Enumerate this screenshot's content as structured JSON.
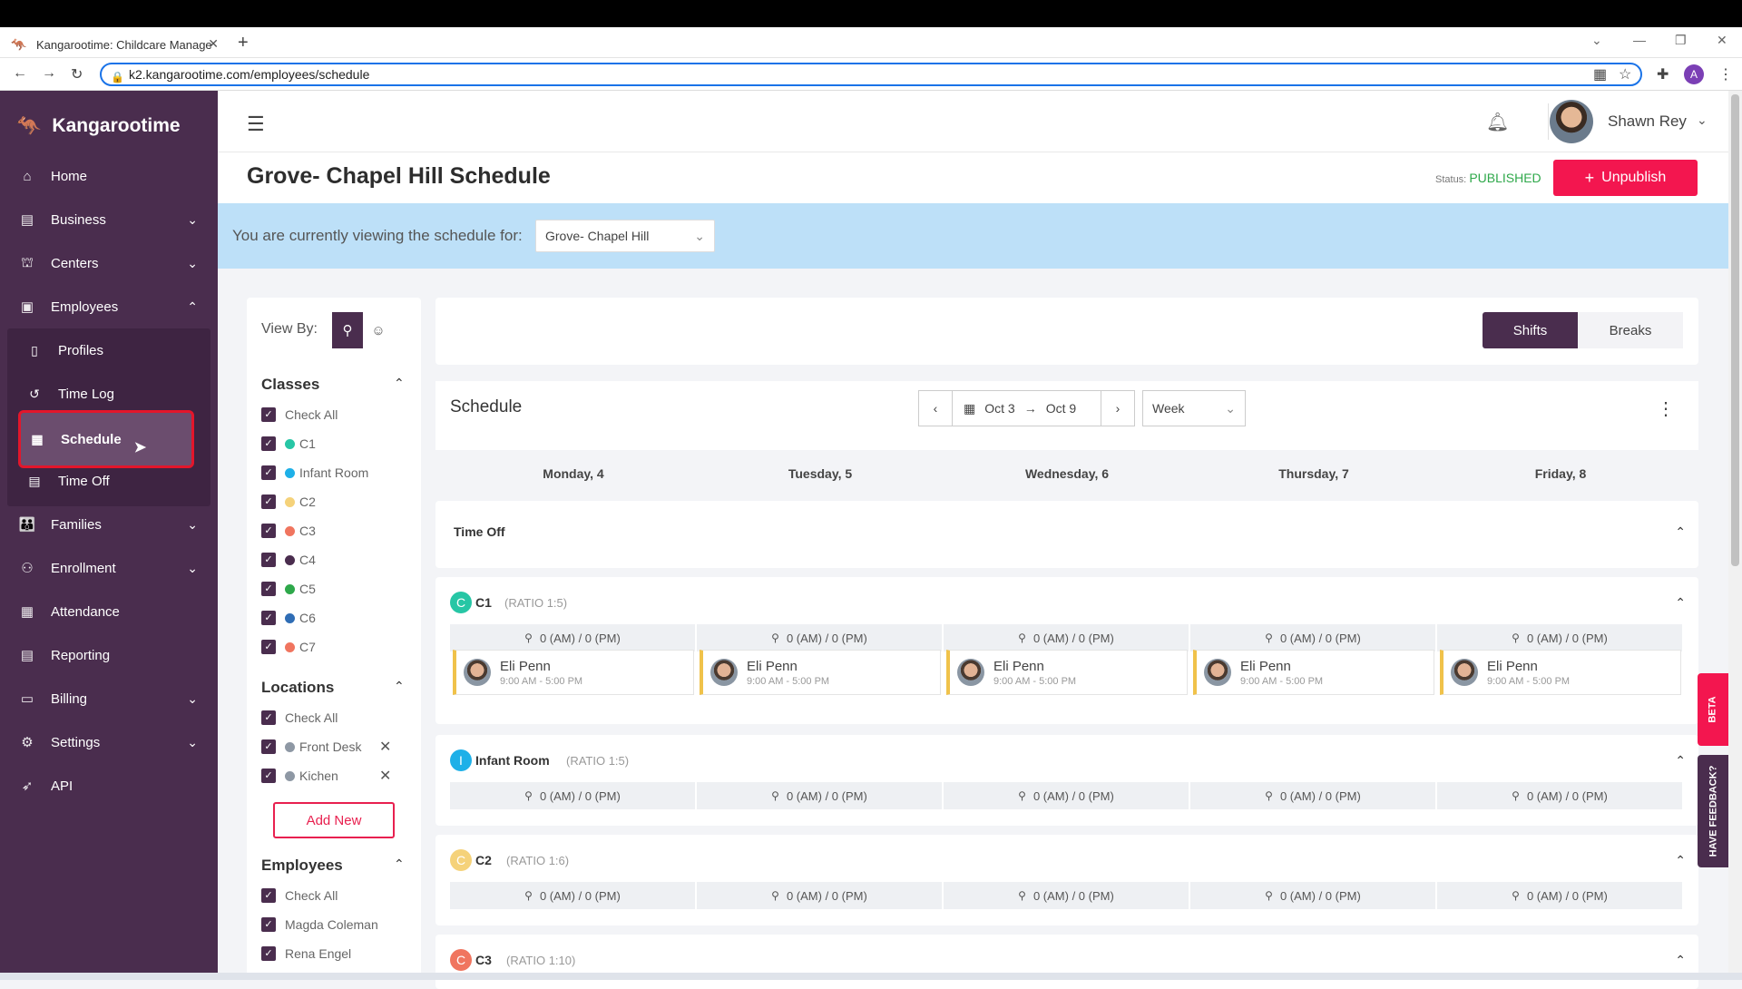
{
  "browser": {
    "tab_title": "Kangarootime: Childcare Manage",
    "url": "k2.kangarootime.com/employees/schedule"
  },
  "sidebar": {
    "brand": "Kangarootime",
    "items": [
      {
        "label": "Home",
        "icon": "home-icon"
      },
      {
        "label": "Business",
        "icon": "building-icon"
      },
      {
        "label": "Centers",
        "icon": "center-icon"
      },
      {
        "label": "Employees",
        "icon": "badge-icon"
      },
      {
        "label": "Families",
        "icon": "people-icon"
      },
      {
        "label": "Enrollment",
        "icon": "add-user-icon"
      },
      {
        "label": "Attendance",
        "icon": "calendar-check-icon"
      },
      {
        "label": "Reporting",
        "icon": "report-icon"
      },
      {
        "label": "Billing",
        "icon": "card-icon"
      },
      {
        "label": "Settings",
        "icon": "gear-icon"
      },
      {
        "label": "API",
        "icon": "rocket-icon"
      }
    ],
    "sub_items": [
      {
        "label": "Profiles"
      },
      {
        "label": "Time Log"
      },
      {
        "label": "Schedule"
      },
      {
        "label": "Time Off"
      }
    ]
  },
  "header": {
    "user_name": "Shawn Rey"
  },
  "page": {
    "title": "Grove- Chapel Hill Schedule",
    "status_label": "Status:",
    "status_value": "PUBLISHED",
    "unpublish_label": "Unpublish",
    "banner_text": "You are currently viewing the schedule for:",
    "center_select": "Grove- Chapel Hill"
  },
  "filters": {
    "view_by": "View By:",
    "classes_title": "Classes",
    "classes": [
      {
        "label": "Check All",
        "color": ""
      },
      {
        "label": "C1",
        "color": "#27c6a5"
      },
      {
        "label": "Infant Room",
        "color": "#1eb0e8"
      },
      {
        "label": "C2",
        "color": "#f5d27a"
      },
      {
        "label": "C3",
        "color": "#f0755f"
      },
      {
        "label": "C4",
        "color": "#4a2d4e"
      },
      {
        "label": "C5",
        "color": "#2ea84a"
      },
      {
        "label": "C6",
        "color": "#2f6db5"
      },
      {
        "label": "C7",
        "color": "#f0755f"
      }
    ],
    "locations_title": "Locations",
    "locations": [
      {
        "label": "Check All",
        "color": ""
      },
      {
        "label": "Front Desk",
        "color": "#8e98a4"
      },
      {
        "label": "Kichen",
        "color": "#8e98a4"
      }
    ],
    "add_new": "Add New",
    "employees_title": "Employees",
    "employees": [
      {
        "label": "Check All"
      },
      {
        "label": "Magda Coleman"
      },
      {
        "label": "Rena Engel"
      }
    ]
  },
  "toolbar": {
    "shifts": "Shifts",
    "breaks": "Breaks",
    "schedule_title": "Schedule",
    "date_start": "Oct 3",
    "date_end": "Oct 9",
    "range": "Week"
  },
  "days": [
    "Monday, 4",
    "Tuesday, 5",
    "Wednesday, 6",
    "Thursday, 7",
    "Friday, 8"
  ],
  "time_off_title": "Time Off",
  "ratio_text": "0 (AM) / 0 (PM)",
  "classes": [
    {
      "badge": "C",
      "name": "C1",
      "ratio": "(RATIO 1:5)",
      "color": "#27c6a5"
    },
    {
      "badge": "I",
      "name": "Infant Room",
      "ratio": "(RATIO 1:5)",
      "color": "#1eb0e8"
    },
    {
      "badge": "C",
      "name": "C2",
      "ratio": "(RATIO 1:6)",
      "color": "#f5d27a"
    },
    {
      "badge": "C",
      "name": "C3",
      "ratio": "(RATIO 1:10)",
      "color": "#f0755f"
    }
  ],
  "shift": {
    "name": "Eli Penn",
    "time": "9:00 AM - 5:00 PM"
  },
  "side_tabs": {
    "beta": "BETA",
    "feedback": "HAVE FEEDBACK?"
  }
}
